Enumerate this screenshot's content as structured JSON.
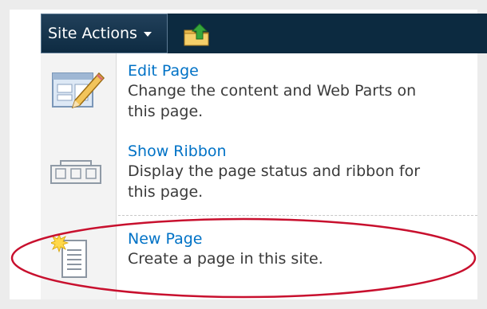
{
  "toolbar": {
    "site_actions_label": "Site Actions",
    "site_actions_icon": "chevron-down-icon",
    "navigate_up_icon": "folder-up-arrow-icon"
  },
  "menu": {
    "items": [
      {
        "title": "Edit Page",
        "description": "Change the content and Web Parts on this page.",
        "icon": "edit-page-icon"
      },
      {
        "title": "Show Ribbon",
        "description": "Display the page status and ribbon for this page.",
        "icon": "ribbon-icon"
      },
      {
        "title": "New Page",
        "description": "Create a page in this site.",
        "icon": "new-page-icon"
      }
    ]
  },
  "colors": {
    "topbar": "#0c2a40",
    "link": "#0072c6",
    "highlight_ellipse": "#c8102e"
  }
}
